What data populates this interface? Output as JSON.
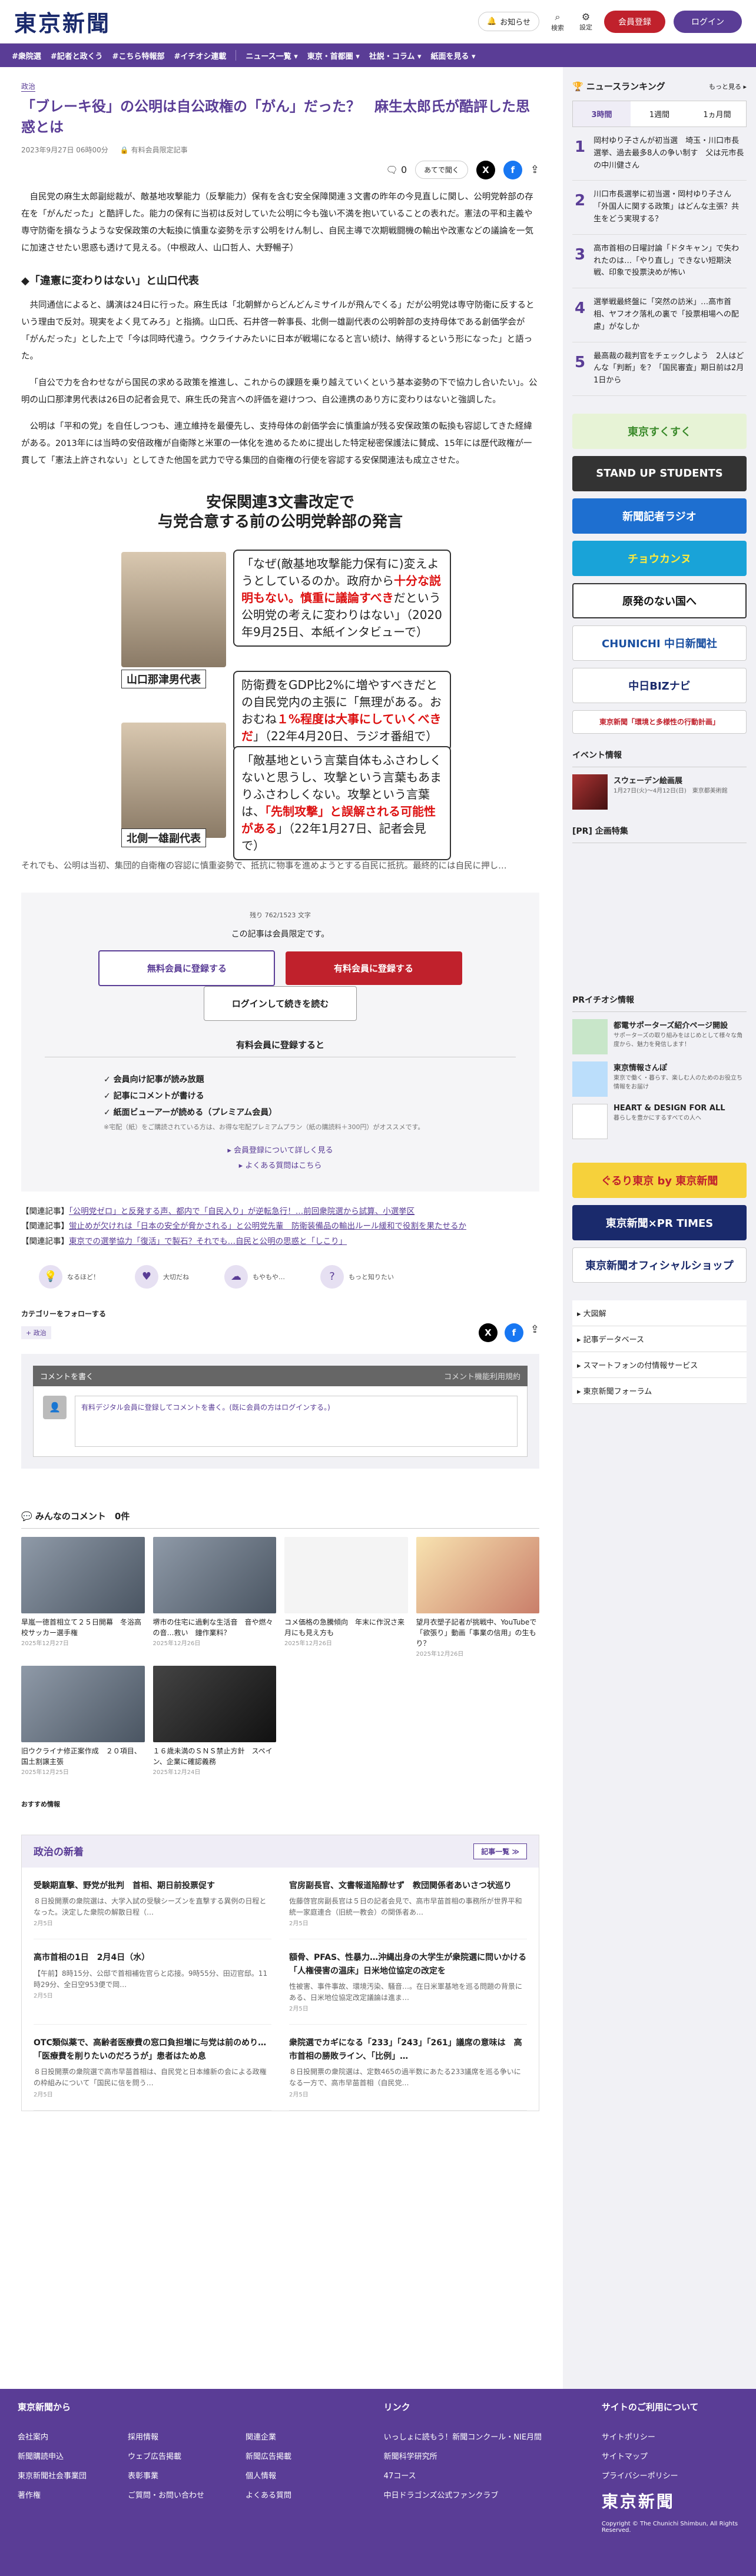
{
  "header": {
    "logo": "東京新聞",
    "notify": "お知らせ",
    "search": "検索",
    "settings": "設定",
    "signup": "会員登録",
    "login": "ログイン"
  },
  "nav": [
    "#衆院選",
    "#記者と政くう",
    "#こちら特報部",
    "#イチオシ連載",
    "ニュース一覧 ▾",
    "東京・首都圏 ▾",
    "社説・コラム ▾",
    "紙面を見る ▾"
  ],
  "article": {
    "tag": "政治",
    "title": "「ブレーキ役」の公明は自公政権の「がん」だった？　麻生太郎氏が酷評した思惑とは",
    "date": "2023年9月27日 06時00分",
    "members": "有料会員限定記事",
    "count": "0",
    "listen": "あてで聞く",
    "p1": "自民党の麻生太郎副総裁が、敵基地攻撃能力（反撃能力）保有を含む安全保障関連３文書の昨年の今見直しに関し、公明党幹部の存在を「がんだった」と酷評した。能力の保有に当初は反対していた公明に今も強い不満を抱いていることの表れだ。憲法の平和主義や専守防衛を損なうような安保政策の大転換に慎重な姿勢を示す公明をけん制し、自民主導で次期戦闘機の輸出や改憲などの議論を一気に加速させたい思惑も透けて見える。（中根政人、山口哲人、大野暢子）",
    "h2": "◆「違憲に変わりはない」と山口代表",
    "p2": "共同通信によると、講演は24日に行った。麻生氏は「北朝鮮からどんどんミサイルが飛んでくる」だが公明党は専守防衛に反するという理由で反対。現実をよく見てみろ」と指摘。山口氏、石井啓一幹事長、北側一雄副代表の公明幹部の支持母体である創価学会が「がんだった」とした上で「今は同時代違う。ウクライナみたいに日本が戦場になると言い続け、納得するという形になった」と語った。",
    "p3": "「自公で力を合わせながら国民の求める政策を推進し、これからの課題を乗り越えていくという基本姿勢の下で協力し合いたい」。公明の山口那津男代表は26日の記者会見で、麻生氏の発言への評価を避けつつ、自公連携のあり方に変わりはないと強調した。",
    "p4": "公明は「平和の党」を自任しつつも、連立維持を最優先し、支持母体の創価学会に慎重論が残る安保政策の転換も容認してきた経緯がある。2013年には当時の安倍政権が自衛隊と米軍の一体化を進めるために提出した特定秘密保護法に賛成、15年には歴代政権が一貫して「憲法上許されない」としてきた他国を武力で守る集団的自衛権の行使を容認する安保関連法も成立させた。",
    "p5": "それでも、公明は当初、集団的自衛権の容認に慎重姿勢で、抵抗に物事を進めようとする自民に抵抗。最終的には自民に押し…"
  },
  "figure": {
    "title1": "安保関連3文書改定で",
    "title2": "与党合意する前の公明党幹部の発言",
    "q1a": "「なぜ(敵基地攻撃能力保有に)変えようとしているのか。政府から",
    "q1r": "十分な説明もない。慎重に議論すべき",
    "q1b": "だという公明党の考えに変わりはない」（2020年9月25日、本紙インタビューで）",
    "name1": "山口那津男代表",
    "q2a": "防衛費をGDP比2%に増やすべきだとの自民党内の主張に「無理がある。おおむね",
    "q2r": "１%程度は大事にしていくべきだ",
    "q2b": "」（22年4月20日、ラジオ番組で）",
    "q3a": "「敵基地という言葉自体もふさわしくないと思うし、攻撃という言葉もあまりふさわしくない。攻撃という言葉は、",
    "q3r": "「先制攻撃」と誤解される可能性がある",
    "q3b": "」（22年1月27日、記者会見で）",
    "name2": "北側一雄副代表"
  },
  "paywall": {
    "remain": "残り 762/1523 文字",
    "msg": "この記事は会員限定です。",
    "free": "無料会員に登録する",
    "paid": "有料会員に登録する",
    "login": "ログインして続きを読む",
    "benefit_title": "有料会員に登録すると",
    "b1": "✓ 会員向け記事が読み放題",
    "b2": "✓ 記事にコメントが書ける",
    "b3": "✓ 紙面ビューアーが読める（プレミアム会員）",
    "note": "※宅配（紙）をご購読されている方は、お得な宅配プレミアムプラン（紙の購読料＋300円）がオススメです。",
    "more": "▸ 会員登録について詳しく見る",
    "faq": "▸ よくある質問はこちら"
  },
  "related": [
    {
      "label": "【関連記事】",
      "text": "「公明党ゼロ」と反発する声、都内で「自民入り」が逆転急行！…前回衆院選から試算、小選挙区"
    },
    {
      "label": "【関連記事】",
      "text": "蛍止めが欠けれは「日本の安全が脅かされる」と公明党先輩　防衛装備品の輸出ルール緩和で役割を果たせるか"
    },
    {
      "label": "【関連記事】",
      "text": "東京での選挙協力「復活」で製石？それでも…自民と公明の思惑と「しこり」"
    }
  ],
  "reactions": [
    "なるほど！",
    "大切だね",
    "もやもや…",
    "もっと知りたい"
  ],
  "follow": {
    "title": "カテゴリーをフォローする",
    "tag": "+ 政治"
  },
  "comment": {
    "bar": "コメントを書く",
    "rule": "コメント機能利用規約",
    "box": "有料デジタル会員に登録してコメントを書く。(既に会員の方はログインする。)",
    "title": "みんなのコメント　0件"
  },
  "gallery": [
    {
      "cap": "旱嵐一徳首相立て２５日開幕　冬浴高校サッカー選手権",
      "date": "2025年12月27日"
    },
    {
      "cap": "堺市の住宅に過剰な生活音　音や燃々の音…救い　鐘作業料？",
      "date": "2025年12月26日"
    },
    {
      "cap": "コメ価格の急騰傾向　年末に作況さ来月にも見え方も",
      "date": "2025年12月26日"
    },
    {
      "cap": "望月衣塑子記者が挑戦中、YouTubeで「欲張り」動画「事業の信用」の生もり？",
      "date": "2025年12月26日"
    },
    {
      "cap": "旧ウクライナ修正案作成　２０項目、国土割譲主張",
      "date": "2025年12月25日"
    },
    {
      "cap": "１６歳未満のＳＮＳ禁止方針　スペイン、企業に確認義務",
      "date": "2025年12月24日"
    }
  ],
  "recommend": "おすすめ情報",
  "politics": {
    "title": "政治の新着",
    "more": "記事一覧 ≫",
    "items": [
      {
        "h": "受験期直撃、野党が批判　首相、期日前投票促す",
        "p": "８日投開票の衆院選は、大学入試の受験シーズンを直撃する異例の日程となった。決定した衆院の解散日程（…",
        "d": "2月5日"
      },
      {
        "h": "官房副長官、文書報道陥醇せず　教団関係者あいさつ状巡り",
        "p": "佐藤啓官房副長官は５日の記者会見で、高市早苗首相の事務所が世界平和統一家庭連合（旧統一教会）の関係者あ…",
        "d": "2月5日"
      },
      {
        "h": "高市首相の1日　2月4日（水）",
        "p": "【午前】8時15分、公邸で首相補佐官らと応接。9時55分、田辺官邸。11時29分、全日空953便で岡…",
        "d": "2月5日"
      },
      {
        "h": "額骨、PFAS、性暴力…沖縄出身の大学生が衆院選に問いかける「人権侵害の温床」日米地位協定の改定を",
        "p": "性被害、事件事故、環境汚染、騒音…。在日米軍基地を巡る問題の背景にある、日米地位協定改定議論は進ま…",
        "d": "2月5日"
      },
      {
        "h": "OTC類似薬で、高齢者医療費の窓口負担増に与党は前のめり…「医療費を削りたいのだろうが」患者はため息",
        "p": "８日投開票の衆院選で高市早苗首相は、自民党と日本維新の会による政権の枠組みについて「国民に信を問う…",
        "d": "2月5日"
      },
      {
        "h": "衆院選でカギになる「233」「243」「261」議席の意味は　高市首相の勝敗ライン、「比例」…",
        "p": "８日投開票の衆院選は、定数465の過半数にあたる233議席を巡る争いになる一方で、高市早苗首相（自民党…",
        "d": "2月5日"
      }
    ]
  },
  "sidebar": {
    "ranking_title": "ニュースランキング",
    "ranking_more": "もっと見る ▸",
    "tabs": [
      "3時間",
      "1週間",
      "1ヵ月間"
    ],
    "ranks": [
      {
        "n": "1",
        "t": "岡村ゆり子さんが初当選　埼玉・川口市長選挙、過去最多8人の争い制す　父は元市長の中川健さん"
      },
      {
        "n": "2",
        "t": "川口市長選挙に初当選・岡村ゆり子さん「外国人に関する政策」はどんな主張？共生をどう実現する？"
      },
      {
        "n": "3",
        "t": "高市首相の日曜討論「ドタキャン」で失われたのは…「やり直し」できない短期決戦、印象で投票決めが怖い"
      },
      {
        "n": "4",
        "t": "選挙戦最終盤に「突然の訪米」…高市首相、ヤフオク落札の裏で「投票相場への配慮」がなしか"
      },
      {
        "n": "5",
        "t": "最高裁の裁判官をチェックしよう　2人はどんな「判断」を？「国民審査」期日前は2月1日から"
      }
    ],
    "banners": [
      "東京すくすく",
      "STAND UP STUDENTS",
      "新聞記者ラジオ",
      "チョウカンヌ",
      "原発のない国へ",
      "CHUNICHI 中日新聞社",
      "中日BIZナビ",
      "東京新聞「環境と多様性の行動計画」"
    ],
    "event_title": "イベント情報",
    "event": {
      "t": "スウェーデン絵画展",
      "p": "1月27日(火)～4月12日(日)　東京都美術館"
    },
    "pr_title": "[PR] 企画特集",
    "pr2_title": "PRイチオシ情報",
    "pr2": [
      {
        "t": "都電サポーターズ紹介ページ開設",
        "p": "サポーターズの取り組みをはじめとして様々な角度から、魅力を発信します！"
      },
      {
        "t": "東京情報さんぽ",
        "p": "東京で働く・暮らす、楽しむ人のためのお役立ち情報をお届け"
      },
      {
        "t": "HEART & DESIGN FOR ALL",
        "p": "暮らしを豊かにするすべての人へ"
      }
    ],
    "banners2": [
      "ぐるり東京 by 東京新聞",
      "東京新聞×PR TIMES",
      "東京新聞オフィシャルショップ"
    ],
    "links": [
      "▸ 大図解",
      "▸ 記事データベース",
      "▸ スマートフォンの付情報サービス",
      "▸ 東京新聞フォーラム"
    ]
  },
  "footer": {
    "c1": "東京新聞から",
    "c1items": [
      "会社案内",
      "新聞購読申込",
      "東京新聞社会事業団",
      "著作権"
    ],
    "c1b": [
      "採用情報",
      "ウェブ広告掲載",
      "表彰事業",
      "ご質問・お問い合わせ"
    ],
    "c1c": [
      "関連企業",
      "新聞広告掲載",
      "個人情報",
      "よくある質問"
    ],
    "c2": "リンク",
    "c2items": [
      "いっしょに読もう！新聞コンクール・NIE月間",
      "新聞科学研究所",
      "47コース",
      "中日ドラゴンズ公式ファンクラブ"
    ],
    "c3": "サイトのご利用について",
    "c3items": [
      "サイトポリシー",
      "サイトマップ",
      "プライバシーポリシー"
    ],
    "logo": "東京新聞",
    "copy": "Copyright © The Chunichi Shimbun, All Rights Reserved."
  }
}
